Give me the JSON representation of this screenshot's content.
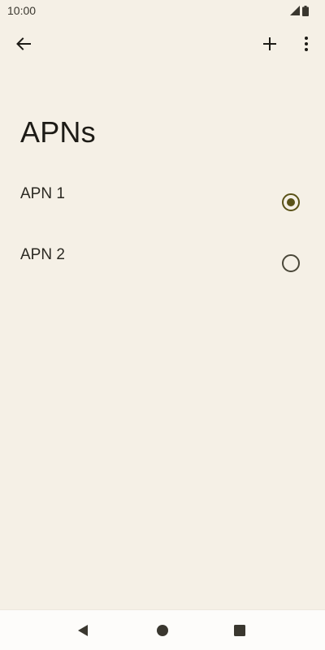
{
  "status_bar": {
    "time": "10:00",
    "icons": [
      "signal-icon",
      "battery-icon"
    ]
  },
  "app_bar": {
    "back_icon": "arrow-back-icon",
    "add_icon": "plus-icon",
    "more_icon": "more-vert-icon"
  },
  "page": {
    "title": "APNs"
  },
  "apns": [
    {
      "label": "APN 1",
      "selected": true
    },
    {
      "label": "APN 2",
      "selected": false
    }
  ],
  "nav_bar": {
    "icons": [
      "nav-back-icon",
      "nav-home-icon",
      "nav-recents-icon"
    ]
  },
  "colors": {
    "background": "#f5f0e6",
    "accent": "#5a5218",
    "nav_background": "#fdfcfa"
  }
}
